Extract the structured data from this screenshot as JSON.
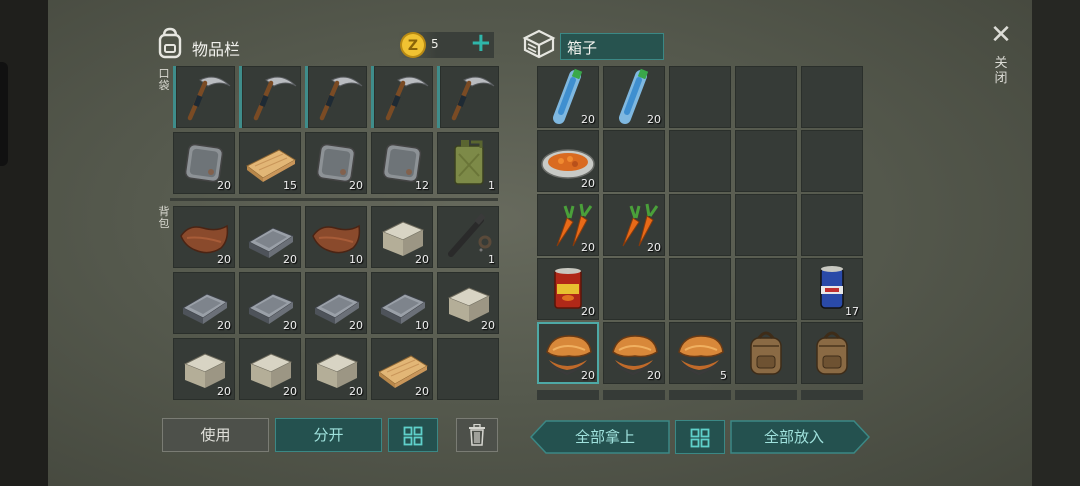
{
  "inventory": {
    "title": "物品栏",
    "coins": "5",
    "add_symbol": "+",
    "pocket_label": "口袋",
    "backpack_label": "背包",
    "pocket_row1": [
      {
        "item": "pickaxe-icon",
        "count": ""
      },
      {
        "item": "pickaxe-icon",
        "count": ""
      },
      {
        "item": "pickaxe-icon",
        "count": ""
      },
      {
        "item": "pickaxe-icon",
        "count": ""
      },
      {
        "item": "pickaxe-icon",
        "count": ""
      }
    ],
    "pocket_row2": [
      {
        "item": "metal-plate-icon",
        "count": "20"
      },
      {
        "item": "wood-plank-icon",
        "count": "15"
      },
      {
        "item": "metal-plate-icon",
        "count": "20"
      },
      {
        "item": "metal-plate-icon",
        "count": "12"
      },
      {
        "item": "jerrycan-icon",
        "count": "1"
      }
    ],
    "backpack": [
      [
        {
          "item": "leather-icon",
          "count": "20"
        },
        {
          "item": "iron-ingot-icon",
          "count": "20"
        },
        {
          "item": "leather-icon",
          "count": "10"
        },
        {
          "item": "stone-brick-icon",
          "count": "20"
        },
        {
          "item": "gun-parts-icon",
          "count": "1"
        }
      ],
      [
        {
          "item": "iron-ingot-icon",
          "count": "20"
        },
        {
          "item": "iron-ingot-icon",
          "count": "20"
        },
        {
          "item": "iron-ingot-icon",
          "count": "20"
        },
        {
          "item": "iron-ingot-icon",
          "count": "10"
        },
        {
          "item": "stone-brick-icon",
          "count": "20"
        }
      ],
      [
        {
          "item": "stone-brick-icon",
          "count": "20"
        },
        {
          "item": "stone-brick-icon",
          "count": "20"
        },
        {
          "item": "stone-brick-icon",
          "count": "20"
        },
        {
          "item": "wood-plank-icon",
          "count": "20"
        },
        {
          "item": "",
          "count": ""
        }
      ]
    ],
    "buttons": {
      "use": "使用",
      "split": "分开",
      "sort_icon": "grid-icon",
      "delete_icon": "trash-icon"
    }
  },
  "box": {
    "title": "箱子",
    "rows": [
      [
        {
          "item": "water-bottle-icon",
          "count": "20"
        },
        {
          "item": "water-bottle-icon",
          "count": "20"
        },
        {
          "item": "",
          "count": ""
        },
        {
          "item": "",
          "count": ""
        },
        {
          "item": "",
          "count": ""
        }
      ],
      [
        {
          "item": "carrot-dish-icon",
          "count": "20"
        },
        {
          "item": "",
          "count": ""
        },
        {
          "item": "",
          "count": ""
        },
        {
          "item": "",
          "count": ""
        },
        {
          "item": "",
          "count": ""
        }
      ],
      [
        {
          "item": "carrot-icon",
          "count": "20"
        },
        {
          "item": "carrot-icon",
          "count": "20"
        },
        {
          "item": "",
          "count": ""
        },
        {
          "item": "",
          "count": ""
        },
        {
          "item": "",
          "count": ""
        }
      ],
      [
        {
          "item": "food-can-icon",
          "count": "20"
        },
        {
          "item": "",
          "count": ""
        },
        {
          "item": "",
          "count": ""
        },
        {
          "item": "",
          "count": ""
        },
        {
          "item": "beer-can-icon",
          "count": "17"
        }
      ],
      [
        {
          "item": "mushroom-icon",
          "count": "20"
        },
        {
          "item": "mushroom-icon",
          "count": "20"
        },
        {
          "item": "mushroom-icon",
          "count": "5"
        },
        {
          "item": "backpack-icon",
          "count": ""
        },
        {
          "item": "backpack-icon",
          "count": ""
        }
      ]
    ],
    "buttons": {
      "take_all": "全部拿上",
      "put_all": "全部放入",
      "sort_icon": "grid-icon"
    }
  },
  "close": {
    "symbol": "✕",
    "label": "关闭"
  },
  "colors": {
    "accent": "#3f8d8b",
    "button_teal": "#24514f",
    "slot": "#363b37"
  }
}
